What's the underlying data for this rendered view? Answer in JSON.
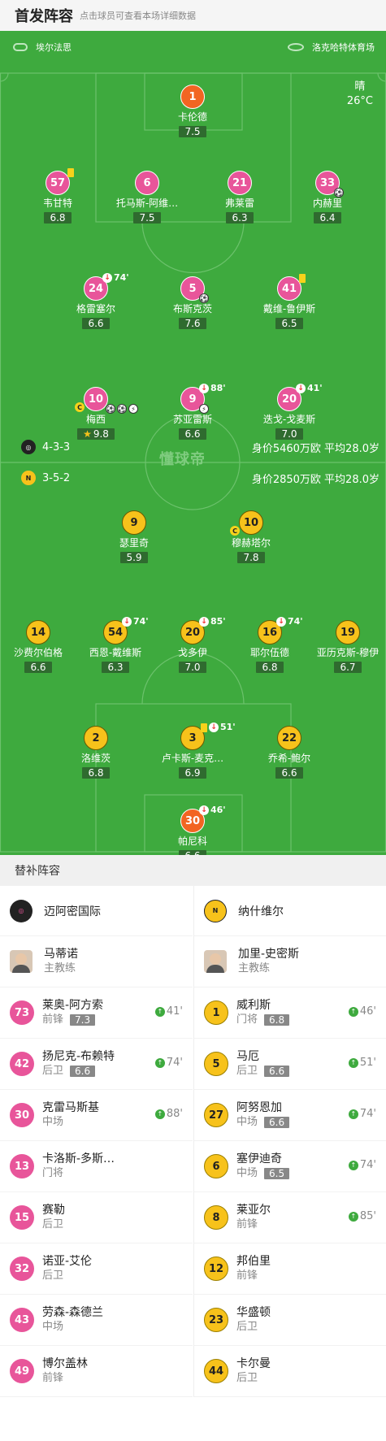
{
  "header": {
    "title": "首发阵容",
    "subtitle": "点击球员可查看本场详细数据"
  },
  "match": {
    "referee": "埃尔法思",
    "venue": "洛克哈特体育场",
    "weather": "晴",
    "temperature": "26°C"
  },
  "home": {
    "formation": "4-3-3",
    "value": "身价5460万欧 平均28.0岁",
    "color": "#e8559a",
    "players": [
      {
        "num": "1",
        "name": "卡伦德",
        "rating": "7.5",
        "gk": true
      },
      {
        "num": "57",
        "name": "韦甘特",
        "rating": "6.8",
        "yellow": true
      },
      {
        "num": "6",
        "name": "托马斯-阿维…",
        "rating": "7.5"
      },
      {
        "num": "21",
        "name": "弗莱雷",
        "rating": "6.3"
      },
      {
        "num": "33",
        "name": "内赫里",
        "rating": "6.4"
      },
      {
        "num": "24",
        "name": "格雷塞尔",
        "rating": "6.6",
        "sub": "74'"
      },
      {
        "num": "5",
        "name": "布斯克茨",
        "rating": "7.6"
      },
      {
        "num": "41",
        "name": "戴维-鲁伊斯",
        "rating": "6.5",
        "yellow": true
      },
      {
        "num": "10",
        "name": "梅西",
        "rating": "9.8",
        "captain": true,
        "mvp": true
      },
      {
        "num": "9",
        "name": "苏亚雷斯",
        "rating": "6.6",
        "sub": "88'"
      },
      {
        "num": "20",
        "name": "迭戈-戈麦斯",
        "rating": "7.0",
        "sub": "41'"
      }
    ]
  },
  "away": {
    "formation": "3-5-2",
    "value": "身价2850万欧 平均28.0岁",
    "color": "#f7c21b",
    "players": [
      {
        "num": "9",
        "name": "瑟里奇",
        "rating": "5.9"
      },
      {
        "num": "10",
        "name": "穆赫塔尔",
        "rating": "7.8",
        "captain": true
      },
      {
        "num": "14",
        "name": "沙费尔伯格",
        "rating": "6.6"
      },
      {
        "num": "54",
        "name": "西恩-戴维斯",
        "rating": "6.3",
        "sub": "74'"
      },
      {
        "num": "20",
        "name": "戈多伊",
        "rating": "7.0",
        "sub": "85'"
      },
      {
        "num": "16",
        "name": "耶尔伍德",
        "rating": "6.8",
        "sub": "74'"
      },
      {
        "num": "19",
        "name": "亚历克斯-穆伊",
        "rating": "6.7"
      },
      {
        "num": "2",
        "name": "洛维茨",
        "rating": "6.8"
      },
      {
        "num": "3",
        "name": "卢卡斯-麦克…",
        "rating": "6.9",
        "sub": "51'",
        "yellow": true
      },
      {
        "num": "22",
        "name": "乔希-鲍尔",
        "rating": "6.6"
      },
      {
        "num": "30",
        "name": "帕尼科",
        "rating": "6.6",
        "sub": "46'",
        "gk": true
      }
    ]
  },
  "bench": {
    "title": "替补阵容",
    "home_team": "迈阿密国际",
    "away_team": "纳什维尔",
    "home_coach": {
      "name": "马蒂诺",
      "role": "主教练"
    },
    "away_coach": {
      "name": "加里-史密斯",
      "role": "主教练"
    },
    "home": [
      {
        "num": "73",
        "name": "莱奥-阿方索",
        "pos": "前锋",
        "rating": "7.3",
        "in": "41'"
      },
      {
        "num": "42",
        "name": "扬尼克-布赖特",
        "pos": "后卫",
        "rating": "6.6",
        "in": "74'"
      },
      {
        "num": "30",
        "name": "克雷马斯基",
        "pos": "中场",
        "rating": "",
        "in": "88'"
      },
      {
        "num": "13",
        "name": "卡洛斯-多斯…",
        "pos": "门将",
        "rating": "",
        "in": ""
      },
      {
        "num": "15",
        "name": "赛勒",
        "pos": "后卫",
        "rating": "",
        "in": ""
      },
      {
        "num": "32",
        "name": "诺亚-艾伦",
        "pos": "后卫",
        "rating": "",
        "in": ""
      },
      {
        "num": "43",
        "name": "劳森-森德兰",
        "pos": "中场",
        "rating": "",
        "in": ""
      },
      {
        "num": "49",
        "name": "博尔盖林",
        "pos": "前锋",
        "rating": "",
        "in": ""
      }
    ],
    "away": [
      {
        "num": "1",
        "name": "威利斯",
        "pos": "门将",
        "rating": "6.8",
        "in": "46'"
      },
      {
        "num": "5",
        "name": "马厄",
        "pos": "后卫",
        "rating": "6.6",
        "in": "51'"
      },
      {
        "num": "27",
        "name": "阿努恩加",
        "pos": "中场",
        "rating": "6.6",
        "in": "74'"
      },
      {
        "num": "6",
        "name": "塞伊迪奇",
        "pos": "中场",
        "rating": "6.5",
        "in": "74'"
      },
      {
        "num": "8",
        "name": "莱亚尔",
        "pos": "前锋",
        "rating": "",
        "in": "85'"
      },
      {
        "num": "12",
        "name": "邦伯里",
        "pos": "前锋",
        "rating": "",
        "in": ""
      },
      {
        "num": "23",
        "name": "华盛顿",
        "pos": "后卫",
        "rating": "",
        "in": ""
      },
      {
        "num": "44",
        "name": "卡尔曼",
        "pos": "后卫",
        "rating": "",
        "in": ""
      }
    ]
  },
  "brand": "懂球帝"
}
